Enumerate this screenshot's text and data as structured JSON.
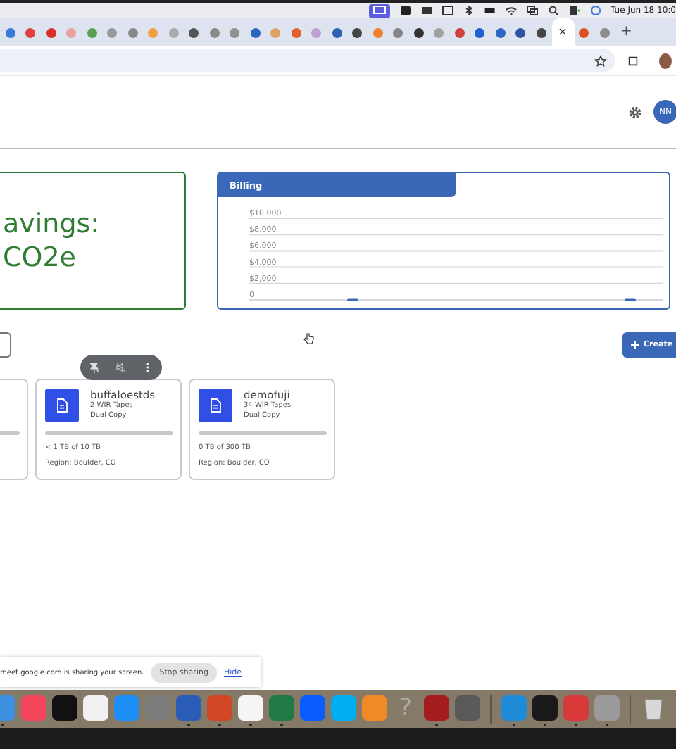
{
  "menubar": {
    "clock": "Tue Jun 18 10:0"
  },
  "browser": {
    "tabs": [
      {
        "color": "#3a7bd5",
        "selected": false
      },
      {
        "color": "#e04040",
        "selected": false
      },
      {
        "color": "#d93025",
        "selected": false
      },
      {
        "color": "#e8a0a0",
        "selected": false
      },
      {
        "color": "#5aa050",
        "selected": false
      },
      {
        "color": "#999999",
        "selected": false
      },
      {
        "color": "#888888",
        "selected": false
      },
      {
        "color": "#f0a040",
        "selected": false
      },
      {
        "color": "#aaaaaa",
        "selected": false
      },
      {
        "color": "#555555",
        "selected": false
      },
      {
        "color": "#8a8a8a",
        "selected": false
      },
      {
        "color": "#909090",
        "selected": false
      },
      {
        "color": "#2a66c0",
        "selected": false
      },
      {
        "color": "#e0a060",
        "selected": false
      },
      {
        "color": "#e06030",
        "selected": false
      },
      {
        "color": "#c0a0d0",
        "selected": false
      },
      {
        "color": "#3060b0",
        "selected": false
      },
      {
        "color": "#444444",
        "selected": false
      },
      {
        "color": "#f08030",
        "selected": false
      },
      {
        "color": "#858585",
        "selected": false
      },
      {
        "color": "#333333",
        "selected": false
      },
      {
        "color": "#a0a0a0",
        "selected": false
      },
      {
        "color": "#d04040",
        "selected": false
      },
      {
        "color": "#2060d0",
        "selected": false
      },
      {
        "color": "#2b67c1",
        "selected": false
      },
      {
        "color": "#3050a0",
        "selected": false
      },
      {
        "color": "#464646",
        "selected": false
      },
      {
        "selected": true
      },
      {
        "color": "#e05020",
        "selected": false
      },
      {
        "color": "#8c8c8c",
        "selected": false
      }
    ],
    "tab_close": "×",
    "new_tab": "+"
  },
  "header": {
    "avatar": "NN"
  },
  "savings_card": {
    "lines": [
      "avings:",
      "CO2e"
    ]
  },
  "billing": {
    "title": "Billing",
    "chart_data": {
      "type": "bar",
      "grid": true,
      "values": [
        300,
        300
      ],
      "ylim": [
        0,
        10000
      ],
      "yticks": [
        {
          "value": 0,
          "label": "0"
        },
        {
          "value": 2000,
          "label": "$2,000"
        },
        {
          "value": 4000,
          "label": "$4,000"
        },
        {
          "value": 6000,
          "label": "$6,000"
        },
        {
          "value": 8000,
          "label": "$8,000"
        },
        {
          "value": 10000,
          "label": "$10,000"
        }
      ]
    }
  },
  "create_button": "Create",
  "cards": [
    {
      "level": 0
    },
    {
      "name": "buffaloestds",
      "tapes": "2 WIR Tapes",
      "copy": "Dual Copy",
      "level": 0,
      "usage": "< 1 TB of 10 TB",
      "region": "Region: Boulder, CO"
    },
    {
      "name": "demofuji",
      "tapes": "34 WIR Tapes",
      "copy": "Dual Copy",
      "level": 0,
      "usage": "0 TB of 300 TB",
      "region": "Region: Boulder, CO"
    }
  ],
  "share_bar": {
    "message": "meet.google.com is sharing your screen.",
    "stop": "Stop sharing",
    "hide": "Hide"
  },
  "dock": [
    {
      "kind": "app",
      "color": "#3d8fe0",
      "running": true
    },
    {
      "kind": "app",
      "color": "#f2445a",
      "running": false
    },
    {
      "kind": "app",
      "color": "#111111",
      "running": false
    },
    {
      "kind": "app",
      "color": "#f0f0f0",
      "running": false
    },
    {
      "kind": "app",
      "color": "#1c8ef5",
      "running": false
    },
    {
      "kind": "app",
      "color": "#7c7c7c",
      "running": false
    },
    {
      "kind": "app",
      "color": "#2b5cb8",
      "running": true
    },
    {
      "kind": "app",
      "color": "#d24726",
      "running": true
    },
    {
      "kind": "app",
      "color": "#f5f5f5",
      "running": true
    },
    {
      "kind": "app",
      "color": "#1f7a44",
      "running": true
    },
    {
      "kind": "app",
      "color": "#0b5cff",
      "running": false
    },
    {
      "kind": "app",
      "color": "#00aff0",
      "running": false
    },
    {
      "kind": "app",
      "color": "#f08a24",
      "running": false
    },
    {
      "kind": "glyph",
      "glyph": "?",
      "running": false
    },
    {
      "kind": "app",
      "color": "#a51c1c",
      "running": true
    },
    {
      "kind": "app",
      "color": "#5a5a5a",
      "running": false
    },
    {
      "kind": "separator"
    },
    {
      "kind": "app",
      "color": "#1d8bd8",
      "running": true
    },
    {
      "kind": "app",
      "color": "#1a1a1a",
      "running": true
    },
    {
      "kind": "app",
      "color": "#d83a3a",
      "running": true
    },
    {
      "kind": "app",
      "color": "#9a9a9a",
      "running": true
    },
    {
      "kind": "separator"
    },
    {
      "kind": "trash",
      "running": false
    }
  ]
}
